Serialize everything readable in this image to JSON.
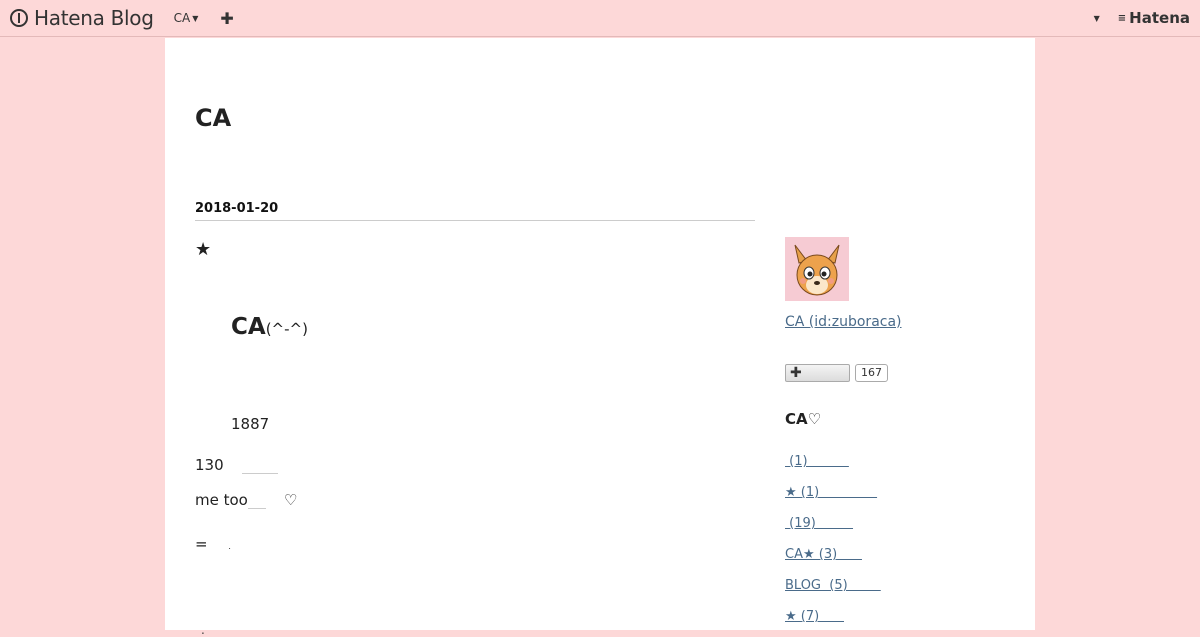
{
  "topbar": {
    "brand": "Hatena Blog",
    "blog_menu": "CA",
    "add_icon": "plus-icon",
    "account_caret": "caret-down-icon",
    "hatena_brand": "Hatena"
  },
  "blog": {
    "title": "CA"
  },
  "entry": {
    "date": "2018-01-20",
    "star": "★",
    "heading": "CA",
    "heading_face": "(^-^)",
    "line_a": "1887",
    "line_b": "130",
    "line_c": "me too",
    "line_c_heart": "♡",
    "line_d": "=",
    "line_d_dot": ".",
    "line_e": "."
  },
  "sidebar": {
    "profile_link": "CA (id:zuboraca)",
    "subscribe_icon": "plus-icon",
    "subscriber_count": "167",
    "category_title": "CA",
    "category_heart": "♡",
    "categories": [
      {
        "label": " (1)          "
      },
      {
        "label": "★ (1)              "
      },
      {
        "label": " (19)         "
      },
      {
        "label": "CA★ (3)      "
      },
      {
        "label": "BLOG  (5)        "
      },
      {
        "label": "★ (7)      "
      }
    ]
  },
  "colors": {
    "background": "#fdd8d8",
    "panel": "#ffffff",
    "link": "#4a6b8a"
  }
}
